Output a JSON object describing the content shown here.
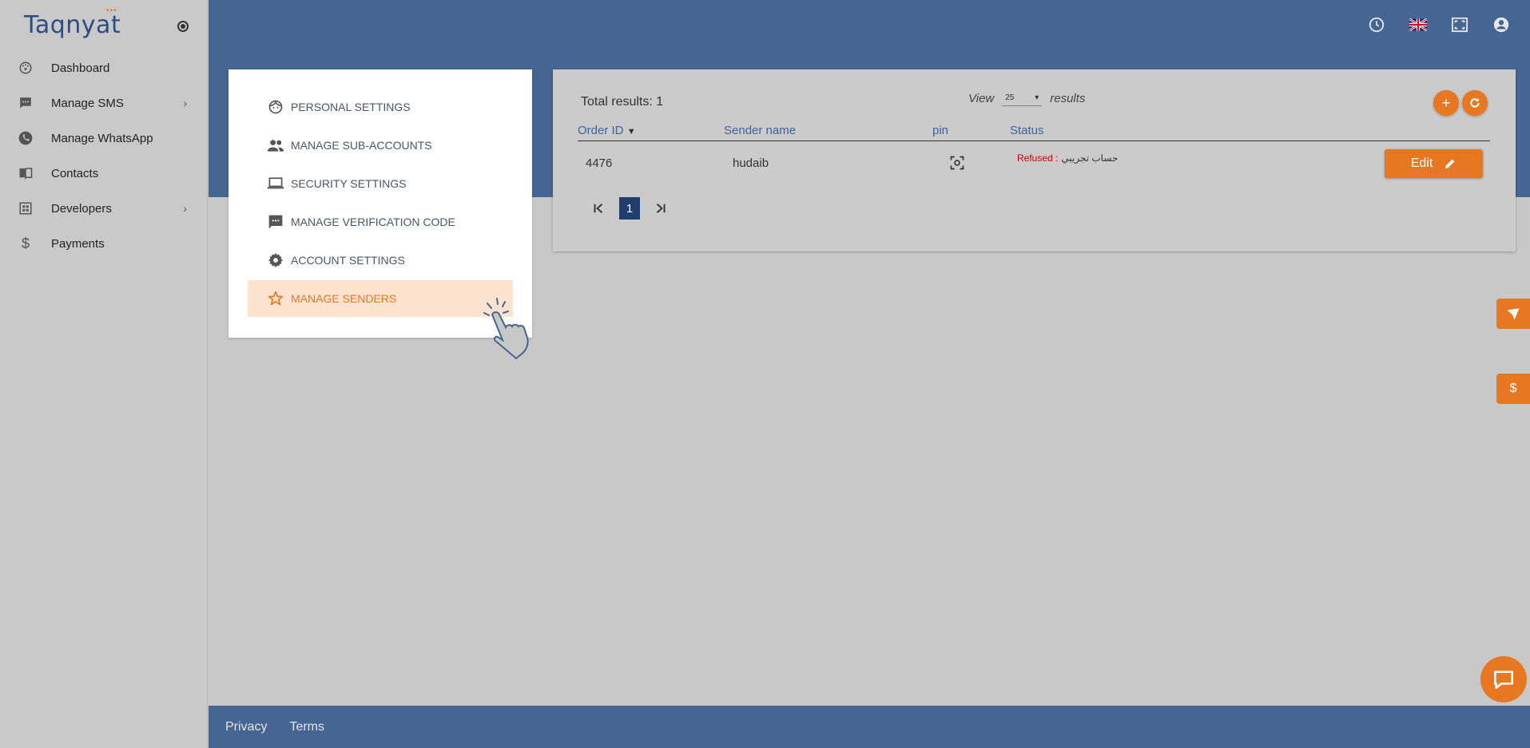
{
  "brand": {
    "name": "Taqnyat",
    "dots": "•••"
  },
  "sidebar": {
    "items": [
      {
        "label": "Dashboard",
        "icon": "dashboard-icon",
        "has_children": false
      },
      {
        "label": "Manage SMS",
        "icon": "sms-icon",
        "has_children": true
      },
      {
        "label": "Manage WhatsApp",
        "icon": "whatsapp-icon",
        "has_children": false
      },
      {
        "label": "Contacts",
        "icon": "contacts-icon",
        "has_children": false
      },
      {
        "label": "Developers",
        "icon": "developers-icon",
        "has_children": true
      },
      {
        "label": "Payments",
        "icon": "dollar-icon",
        "has_children": false
      }
    ]
  },
  "header": {
    "icons": [
      "clock-icon",
      "uk-flag-icon",
      "fullscreen-icon",
      "account-icon"
    ]
  },
  "settings": {
    "items": [
      {
        "label": "PERSONAL SETTINGS",
        "icon": "face-icon",
        "active": false
      },
      {
        "label": "MANAGE SUB-ACCOUNTS",
        "icon": "people-icon",
        "active": false
      },
      {
        "label": "SECURITY SETTINGS",
        "icon": "laptop-icon",
        "active": false
      },
      {
        "label": "MANAGE VERIFICATION CODE",
        "icon": "message-icon",
        "active": false
      },
      {
        "label": "ACCOUNT SETTINGS",
        "icon": "gear-icon",
        "active": false
      },
      {
        "label": "MANAGE SENDERS",
        "icon": "star-icon",
        "active": true
      }
    ]
  },
  "results": {
    "total_label": "Total results: 1",
    "view_label": "View",
    "view_value": "25",
    "results_label": "results",
    "columns": {
      "order_id": "Order ID",
      "sender_name": "Sender name",
      "pin": "pin",
      "status": "Status"
    },
    "rows": [
      {
        "order_id": "4476",
        "sender_name": "hudaib",
        "status_label": "Refused :",
        "status_note": "حساب تجريبي",
        "edit_label": "Edit"
      }
    ],
    "pagination": {
      "current": "1"
    }
  },
  "footer": {
    "privacy": "Privacy",
    "terms": "Terms"
  },
  "colors": {
    "accent": "#e87722",
    "header": "#456593",
    "link": "#3c64a0",
    "refused": "#cc0000"
  }
}
